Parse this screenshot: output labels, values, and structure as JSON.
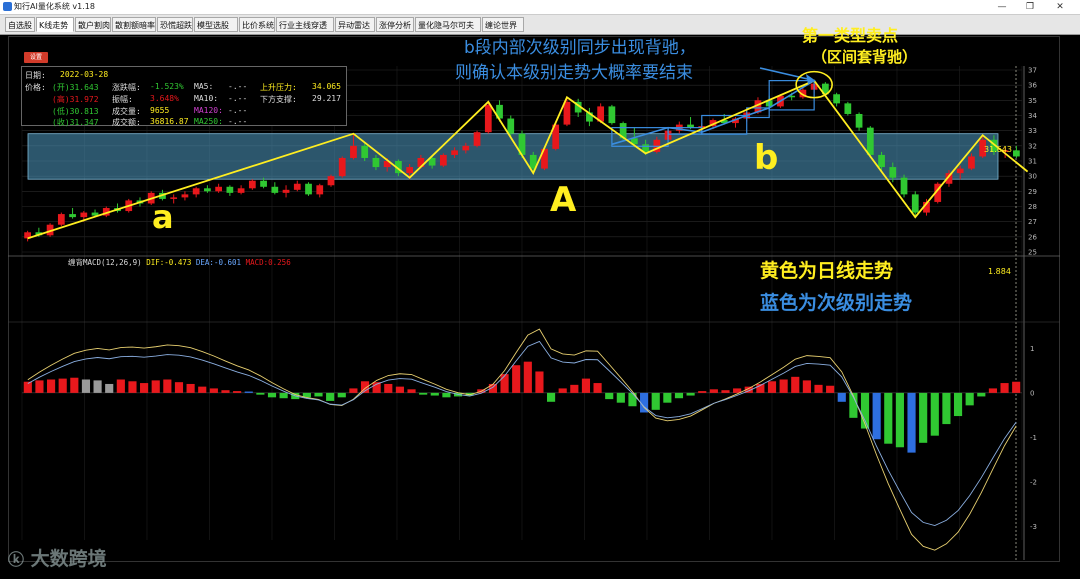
{
  "window": {
    "title": "知行AI量化系统 v1.18",
    "controls": [
      "—",
      "❐",
      "✕"
    ]
  },
  "tabs": [
    {
      "label": "自选股",
      "active": false
    },
    {
      "label": "K线走势",
      "active": true
    },
    {
      "label": "散户割肉",
      "active": false
    },
    {
      "label": "散割额暗率",
      "active": false
    },
    {
      "label": "恐慌超跌",
      "active": false
    },
    {
      "label": "模型选股",
      "active": false
    },
    {
      "label": "比价系统",
      "active": false
    },
    {
      "label": "行业主线穿透",
      "active": false
    },
    {
      "label": "异动雷达",
      "active": false
    },
    {
      "label": "涨停分析",
      "active": false
    },
    {
      "label": "量化隐马尔可夫",
      "active": false
    },
    {
      "label": "缠论世界",
      "active": false
    }
  ],
  "settings_button": "设置",
  "info_panel": {
    "date_label": "日期:",
    "date_value": "2022-03-28",
    "price_label": "价格:",
    "open": "(开)31.643",
    "high": "(高)31.972",
    "low": "(低)30.813",
    "close": "(收)31.347",
    "change_pct_label": "涨跌幅:",
    "change_pct": "-1.523%",
    "amplitude_label": "振幅:",
    "amplitude": "3.648%",
    "volume_label": "成交量:",
    "volume": "9655",
    "amount_label": "成交额:",
    "amount": "36816.87",
    "ma5_label": "MA5:",
    "ma5": "-.--",
    "ma10_label": "MA10:",
    "ma10": "-.--",
    "ma120_label": "MA120:",
    "ma120": "-.--",
    "ma250_label": "MA250:",
    "ma250": "-.--",
    "resistance_label": "上升压力:",
    "resistance": "34.065",
    "support_label": "下方支撑:",
    "support": "29.217"
  },
  "price_axis": [
    "37",
    "36",
    "35",
    "34",
    "33",
    "32",
    "31",
    "30",
    "29",
    "28",
    "27",
    "26",
    "25"
  ],
  "macd_axis": [
    "1",
    "0",
    "-1",
    "-2",
    "-3"
  ],
  "macd_header": {
    "name": "缠背MACD(12,26,9)",
    "dif": "DIF:-0.473",
    "dea": "DEA:-0.601",
    "macd": "MACD:0.256"
  },
  "macd_top_value": "1.884",
  "last_price_label": "31.643",
  "annotations": {
    "sell_title": "第一类型卖点",
    "sell_sub": "（区间套背驰）",
    "divergence_line1": "b段内部次级别同步出现背驰，",
    "divergence_line2": "则确认本级别走势大概率要结束",
    "segment_a": "a",
    "segment_A": "A",
    "segment_b": "b",
    "legend_yellow": "黄色为日线走势",
    "legend_blue": "蓝色为次级别走势"
  },
  "watermark": "大数跨境",
  "colors": {
    "up": "#e8181c",
    "down": "#30c832",
    "yellow": "#ffee20",
    "blue": "#3a8de0",
    "zone": "#4a90b4",
    "bg": "#000000"
  },
  "chart_data": {
    "type": "candlestick",
    "price_range": [
      25,
      37
    ],
    "candles": [
      [
        25.9,
        26.4,
        25.7,
        26.3
      ],
      [
        26.3,
        26.6,
        26.0,
        26.1
      ],
      [
        26.1,
        26.9,
        26.0,
        26.8
      ],
      [
        26.8,
        27.6,
        26.7,
        27.5
      ],
      [
        27.5,
        27.9,
        27.2,
        27.3
      ],
      [
        27.3,
        27.7,
        27.0,
        27.6
      ],
      [
        27.6,
        27.8,
        27.3,
        27.4
      ],
      [
        27.4,
        28.0,
        27.3,
        27.9
      ],
      [
        27.9,
        28.2,
        27.6,
        27.7
      ],
      [
        27.7,
        28.5,
        27.6,
        28.4
      ],
      [
        28.4,
        28.6,
        28.0,
        28.2
      ],
      [
        28.2,
        29.0,
        28.1,
        28.9
      ],
      [
        28.9,
        29.1,
        28.4,
        28.5
      ],
      [
        28.5,
        28.8,
        28.2,
        28.6
      ],
      [
        28.6,
        29.0,
        28.4,
        28.8
      ],
      [
        28.8,
        29.3,
        28.6,
        29.2
      ],
      [
        29.2,
        29.4,
        28.9,
        29.0
      ],
      [
        29.0,
        29.5,
        28.9,
        29.3
      ],
      [
        29.3,
        29.4,
        28.7,
        28.9
      ],
      [
        28.9,
        29.4,
        28.8,
        29.2
      ],
      [
        29.2,
        29.8,
        29.1,
        29.7
      ],
      [
        29.7,
        29.9,
        29.2,
        29.3
      ],
      [
        29.3,
        29.6,
        28.8,
        28.9
      ],
      [
        28.9,
        29.4,
        28.6,
        29.1
      ],
      [
        29.1,
        29.7,
        29.0,
        29.5
      ],
      [
        29.5,
        29.6,
        28.7,
        28.8
      ],
      [
        28.8,
        29.5,
        28.6,
        29.4
      ],
      [
        29.4,
        30.1,
        29.3,
        30.0
      ],
      [
        30.0,
        31.3,
        29.9,
        31.2
      ],
      [
        31.2,
        32.8,
        31.1,
        32.0
      ],
      [
        32.0,
        32.2,
        31.0,
        31.2
      ],
      [
        31.2,
        31.4,
        30.4,
        30.6
      ],
      [
        30.6,
        31.2,
        30.3,
        31.0
      ],
      [
        31.0,
        31.1,
        30.0,
        30.2
      ],
      [
        30.2,
        30.8,
        29.8,
        30.6
      ],
      [
        30.6,
        31.4,
        30.5,
        31.2
      ],
      [
        31.2,
        31.3,
        30.5,
        30.7
      ],
      [
        30.7,
        31.5,
        30.6,
        31.4
      ],
      [
        31.4,
        31.9,
        31.2,
        31.7
      ],
      [
        31.7,
        32.2,
        31.5,
        32.0
      ],
      [
        32.0,
        33.0,
        31.9,
        32.9
      ],
      [
        32.9,
        34.9,
        32.8,
        34.7
      ],
      [
        34.7,
        35.0,
        33.6,
        33.8
      ],
      [
        33.8,
        34.0,
        32.6,
        32.8
      ],
      [
        32.8,
        33.0,
        31.2,
        31.4
      ],
      [
        31.4,
        31.6,
        30.2,
        30.5
      ],
      [
        30.5,
        31.9,
        30.4,
        31.8
      ],
      [
        31.8,
        33.6,
        31.7,
        33.4
      ],
      [
        33.4,
        35.2,
        33.3,
        34.9
      ],
      [
        34.9,
        35.1,
        33.9,
        34.2
      ],
      [
        34.2,
        34.5,
        33.3,
        33.6
      ],
      [
        33.6,
        34.8,
        33.5,
        34.6
      ],
      [
        34.6,
        34.7,
        33.4,
        33.5
      ],
      [
        33.5,
        33.6,
        32.3,
        32.5
      ],
      [
        32.5,
        33.2,
        31.9,
        32.1
      ],
      [
        32.1,
        32.4,
        31.4,
        31.6
      ],
      [
        31.6,
        32.6,
        31.5,
        32.4
      ],
      [
        32.4,
        33.2,
        32.3,
        33.0
      ],
      [
        33.0,
        33.6,
        32.8,
        33.4
      ],
      [
        33.4,
        33.9,
        33.1,
        33.2
      ],
      [
        33.2,
        33.5,
        32.9,
        33.3
      ],
      [
        33.3,
        33.8,
        33.1,
        33.7
      ],
      [
        33.7,
        34.1,
        33.4,
        33.5
      ],
      [
        33.5,
        33.9,
        33.2,
        33.8
      ],
      [
        33.8,
        34.3,
        33.6,
        34.2
      ],
      [
        34.2,
        35.2,
        34.1,
        35.0
      ],
      [
        35.0,
        35.3,
        34.4,
        34.6
      ],
      [
        34.6,
        35.4,
        34.5,
        35.3
      ],
      [
        35.3,
        35.5,
        35.0,
        35.2
      ],
      [
        35.2,
        35.9,
        35.1,
        35.7
      ],
      [
        35.7,
        36.3,
        35.5,
        36.1
      ],
      [
        36.1,
        36.2,
        35.3,
        35.4
      ],
      [
        35.4,
        35.5,
        34.6,
        34.8
      ],
      [
        34.8,
        34.9,
        34.0,
        34.1
      ],
      [
        34.1,
        34.2,
        33.0,
        33.2
      ],
      [
        33.2,
        33.3,
        31.2,
        31.4
      ],
      [
        31.4,
        31.6,
        30.3,
        30.6
      ],
      [
        30.6,
        30.9,
        29.6,
        29.9
      ],
      [
        29.9,
        30.1,
        28.6,
        28.8
      ],
      [
        28.8,
        29.0,
        27.3,
        27.6
      ],
      [
        27.6,
        28.5,
        27.4,
        28.3
      ],
      [
        28.3,
        29.6,
        28.2,
        29.5
      ],
      [
        29.5,
        30.4,
        29.3,
        30.2
      ],
      [
        30.2,
        30.7,
        29.8,
        30.5
      ],
      [
        30.5,
        31.5,
        30.4,
        31.3
      ],
      [
        31.3,
        32.6,
        31.2,
        32.4
      ],
      [
        32.4,
        32.7,
        31.4,
        31.6
      ],
      [
        31.6,
        31.9,
        31.2,
        31.7
      ],
      [
        31.7,
        32.0,
        31.2,
        31.3
      ]
    ],
    "zone": [
      29.8,
      32.8
    ],
    "daily_trend": [
      [
        0,
        25.9
      ],
      [
        29,
        32.8
      ],
      [
        34,
        29.9
      ],
      [
        41,
        34.9
      ],
      [
        45,
        30.2
      ],
      [
        48,
        35.2
      ],
      [
        55,
        31.5
      ],
      [
        70,
        36.3
      ],
      [
        79,
        27.3
      ],
      [
        85,
        32.7
      ],
      [
        89,
        30.3
      ]
    ],
    "sub_trend": [
      [
        52,
        32.1
      ],
      [
        57,
        33.2
      ],
      [
        60,
        32.9
      ],
      [
        64,
        34.0
      ],
      [
        66,
        34.5
      ],
      [
        70,
        36.3
      ]
    ],
    "macd_range": [
      -3.3,
      1.5
    ],
    "macd_hist": [
      0.25,
      0.28,
      0.3,
      0.32,
      0.34,
      0.3,
      0.28,
      0.2,
      0.3,
      0.26,
      0.22,
      0.28,
      0.3,
      0.24,
      0.2,
      0.14,
      0.1,
      0.06,
      0.04,
      0.03,
      -0.04,
      -0.1,
      -0.12,
      -0.14,
      -0.1,
      -0.08,
      -0.18,
      -0.1,
      0.1,
      0.26,
      0.24,
      0.2,
      0.14,
      0.08,
      -0.04,
      -0.06,
      -0.1,
      -0.08,
      -0.06,
      0.08,
      0.2,
      0.42,
      0.62,
      0.7,
      0.48,
      -0.2,
      0.1,
      0.18,
      0.32,
      0.22,
      -0.14,
      -0.22,
      -0.3,
      -0.44,
      -0.38,
      -0.22,
      -0.12,
      -0.06,
      0.04,
      0.08,
      0.06,
      0.1,
      0.14,
      0.2,
      0.26,
      0.3,
      0.36,
      0.28,
      0.18,
      0.16,
      -0.2,
      -0.56,
      -0.8,
      -1.04,
      -1.14,
      -1.22,
      -1.34,
      -1.12,
      -0.96,
      -0.7,
      -0.52,
      -0.28,
      -0.08,
      0.1,
      0.22,
      0.25
    ],
    "macd_blue_idx": [
      19,
      53,
      70,
      73,
      76
    ]
  }
}
